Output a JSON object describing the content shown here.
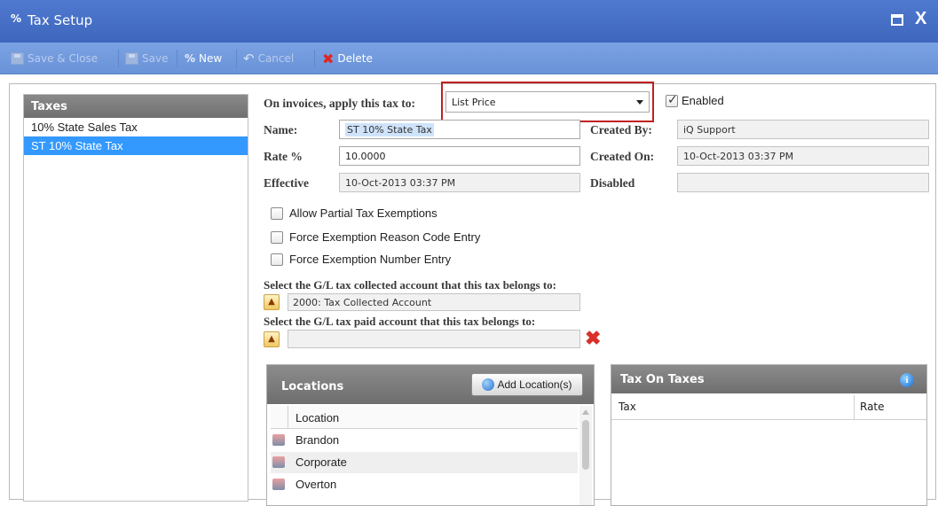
{
  "window": {
    "title": "Tax Setup",
    "icon": "percent-icon"
  },
  "toolbar": {
    "save_close": "Save & Close",
    "save": "Save",
    "new": "New",
    "cancel": "Cancel",
    "delete": "Delete"
  },
  "taxes": {
    "header": "Taxes",
    "items": [
      "10% State Sales Tax",
      "ST 10% State Tax"
    ],
    "selected_index": 1
  },
  "form": {
    "apply_label": "On invoices, apply this tax to:",
    "apply_value": "List Price",
    "enabled_label": "Enabled",
    "enabled": true,
    "name_label": "Name:",
    "name_value": "ST 10% State Tax",
    "rate_label": "Rate %",
    "rate_value": "10.0000",
    "effective_label": "Effective",
    "effective_value": "10-Oct-2013 03:37 PM",
    "created_by_label": "Created By:",
    "created_by_value": "iQ Support",
    "created_on_label": "Created On:",
    "created_on_value": "10-Oct-2013 03:37 PM",
    "disabled_label": "Disabled",
    "disabled_value": ""
  },
  "options": {
    "partial": "Allow Partial Tax Exemptions",
    "reason_code": "Force Exemption Reason Code Entry",
    "exemption_number": "Force Exemption Number Entry"
  },
  "gl": {
    "collected_label": "Select the G/L tax collected account that this tax belongs to:",
    "collected_value": "2000: Tax Collected Account",
    "paid_label": "Select the G/L tax paid account that this tax belongs to:",
    "paid_value": ""
  },
  "locations": {
    "header": "Locations",
    "add_button": "Add Location(s)",
    "column": "Location",
    "rows": [
      "Brandon",
      "Corporate",
      "Overton"
    ]
  },
  "tax_on_taxes": {
    "header": "Tax On Taxes",
    "col_tax": "Tax",
    "col_rate": "Rate"
  }
}
